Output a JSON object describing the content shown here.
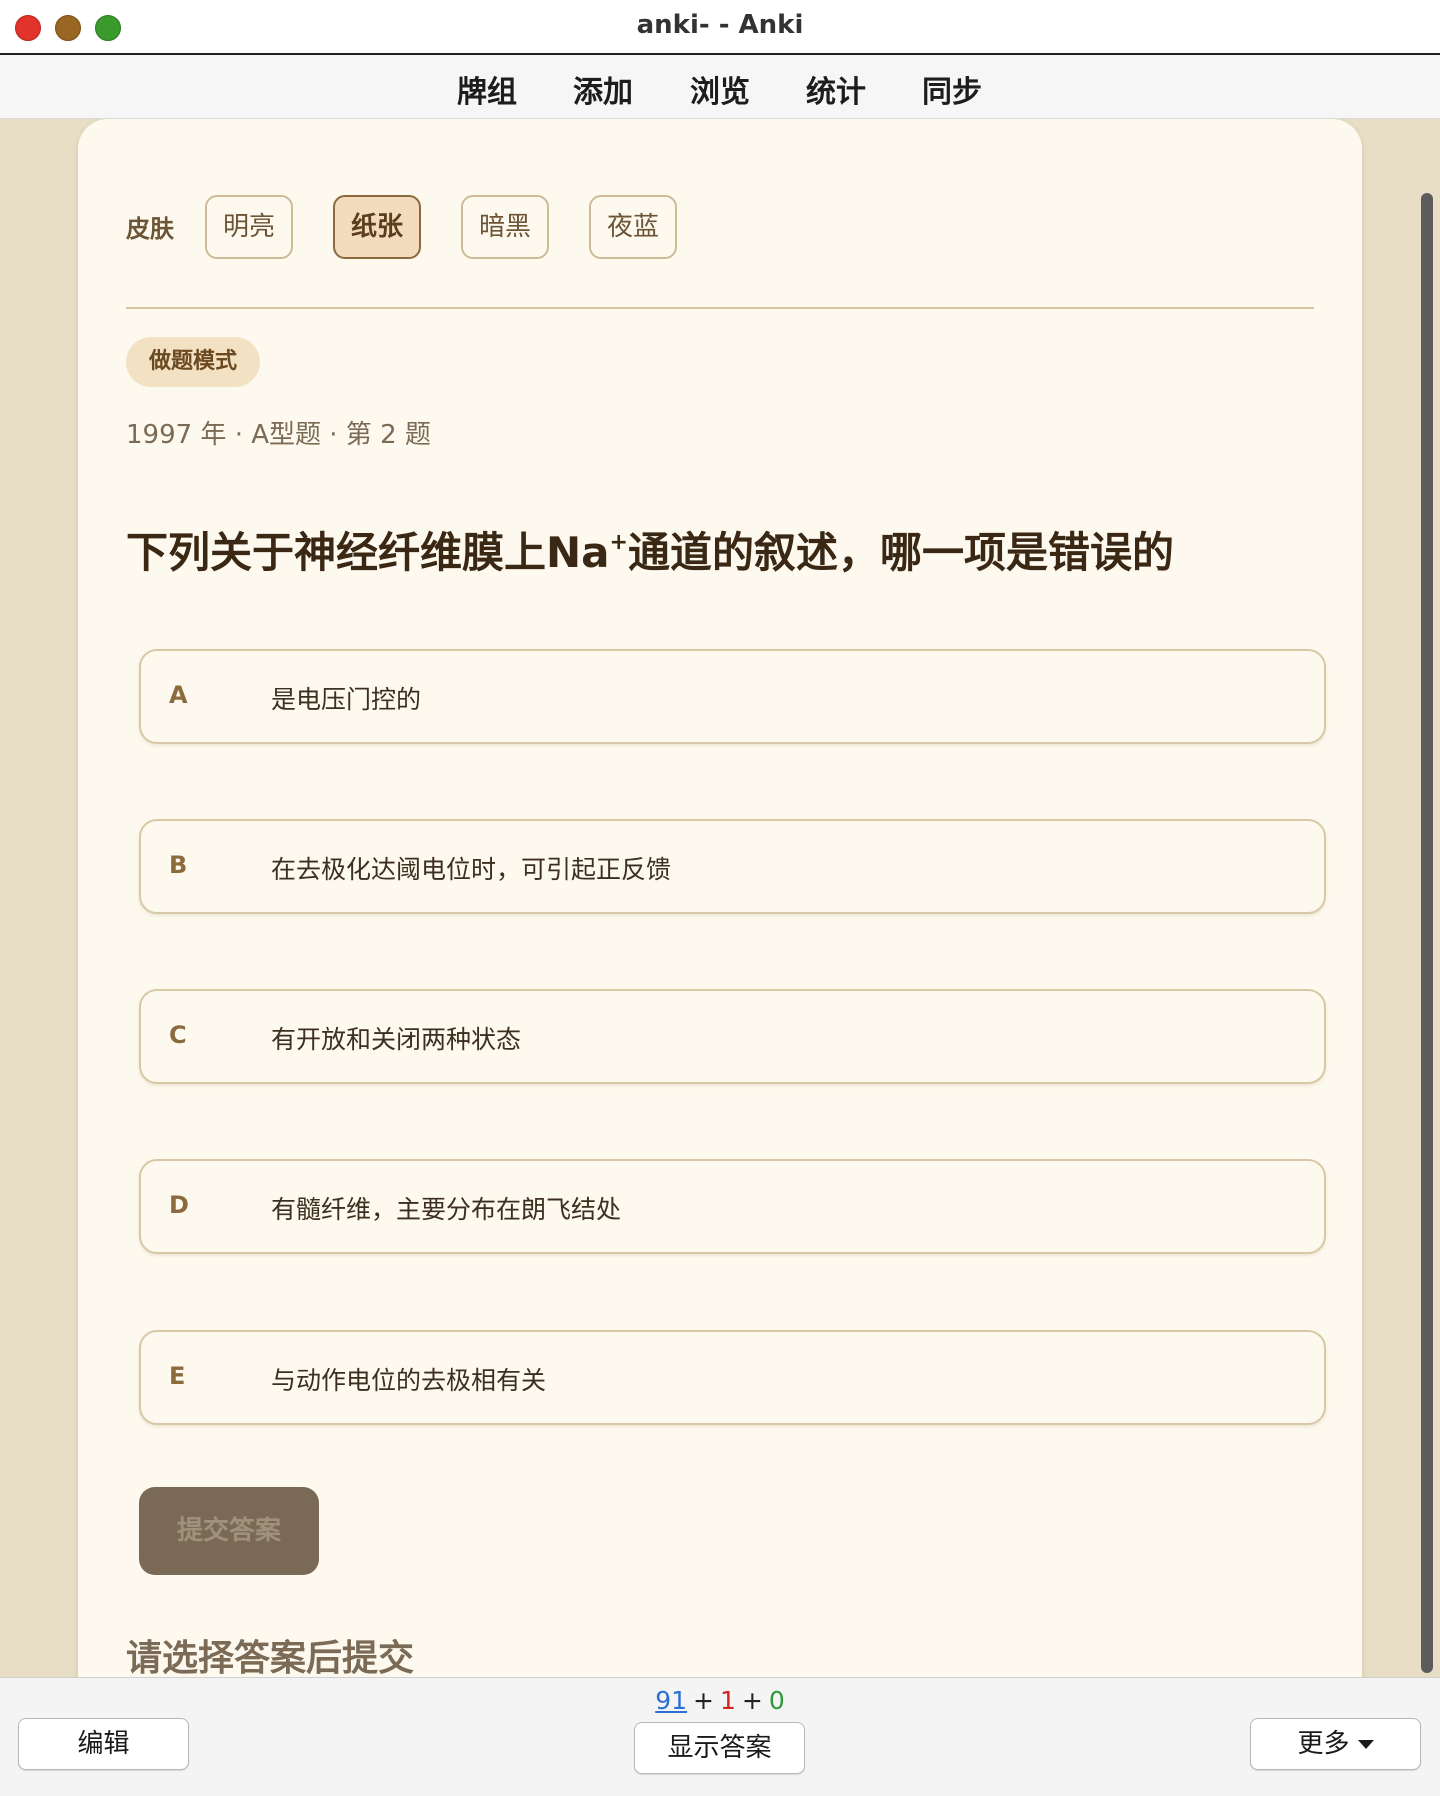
{
  "window": {
    "title": "anki- - Anki"
  },
  "topnav": {
    "items": [
      "牌组",
      "添加",
      "浏览",
      "统计",
      "同步"
    ]
  },
  "skin": {
    "label": "皮肤",
    "options": [
      "明亮",
      "纸张",
      "暗黑",
      "夜蓝"
    ],
    "selected": "纸张"
  },
  "mode_badge": "做题模式",
  "meta": "1997 年 · A型题 · 第 2 题",
  "question": {
    "before": "下列关于神经纤维膜上Na",
    "sup": "+",
    "after": "通道的叙述，哪一项是错误的"
  },
  "options": [
    {
      "letter": "A",
      "text": "是电压门控的"
    },
    {
      "letter": "B",
      "text": "在去极化达阈电位时，可引起正反馈"
    },
    {
      "letter": "C",
      "text": "有开放和关闭两种状态"
    },
    {
      "letter": "D",
      "text": "有髓纤维，主要分布在朗飞结处"
    },
    {
      "letter": "E",
      "text": "与动作电位的去极相有关"
    }
  ],
  "submit_label": "提交答案",
  "hint": "请选择答案后提交",
  "bottombar": {
    "counts": {
      "new": "91",
      "learn": "1",
      "review": "0",
      "plus": "+"
    },
    "edit_label": "编辑",
    "show_answer_label": "显示答案",
    "more_label": "更多"
  },
  "colors": {
    "review_background": "#e8dec6",
    "card_background": "#fdf9ee",
    "accent": "#8b6a3e",
    "count_new": "#2e6fd6",
    "count_learn": "#d02525",
    "count_review": "#2d9b3a"
  }
}
